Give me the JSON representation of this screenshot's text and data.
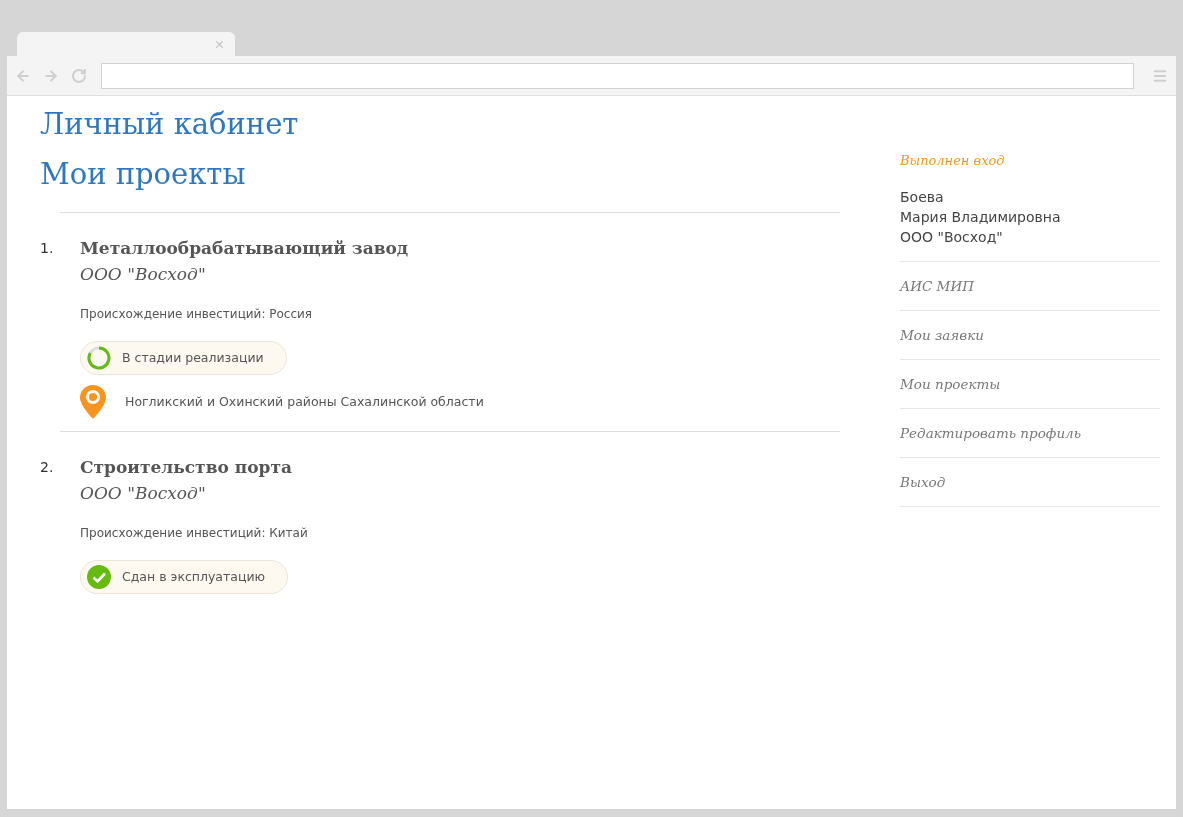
{
  "page": {
    "title": "Личный кабинет",
    "subtitle": "Мои проекты"
  },
  "projects": [
    {
      "number": "1.",
      "title": "Металлообрабатывающий завод",
      "company": "ООО \"Восход\"",
      "origin": "Происхождение инвестиций: Россия",
      "status": {
        "kind": "in_progress",
        "label": "В стадии реализации"
      },
      "location": "Ногликский и Охинский районы Сахалинской области"
    },
    {
      "number": "2.",
      "title": "Строительство порта",
      "company": "ООО \"Восход\"",
      "origin": "Происхождение инвестиций: Китай",
      "status": {
        "kind": "done",
        "label": "Сдан в эксплуатацию"
      }
    }
  ],
  "sidebar": {
    "login_label": "Выполнен вход",
    "user_lines": [
      "Боева",
      "Мария Владимировна",
      "ООО \"Восход\""
    ],
    "menu": [
      "АИС МИП",
      "Мои заявки",
      "Мои проекты",
      "Редактировать профиль",
      "Выход"
    ]
  }
}
